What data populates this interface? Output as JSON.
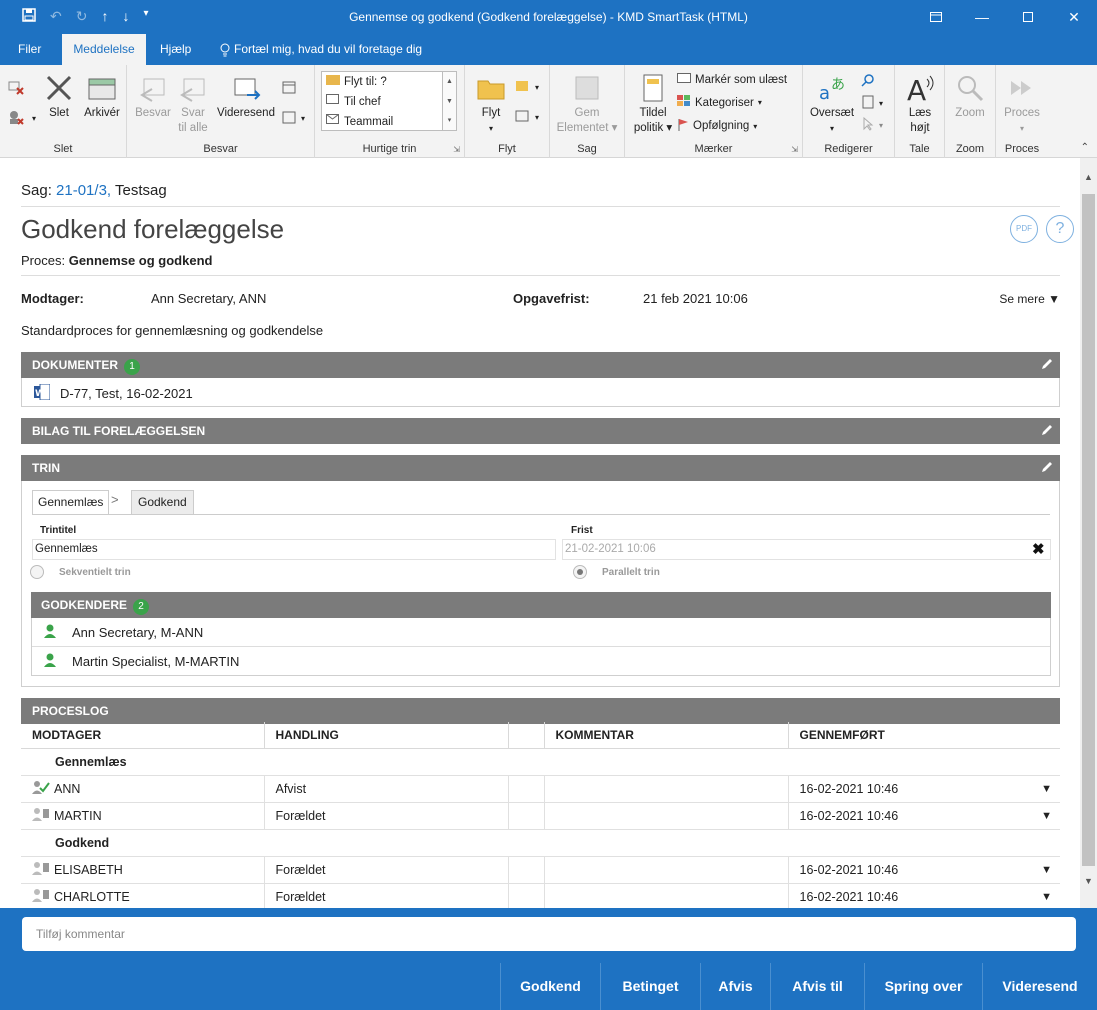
{
  "window": {
    "title": "Gennemse og godkend (Godkend forelæggelse)  -  KMD SmartTask (HTML)"
  },
  "tabs": [
    "Filer",
    "Meddelelse",
    "Hjælp",
    "Fortæl mig, hvad du vil foretage dig"
  ],
  "ribbon": {
    "slet": {
      "delete": "Slet",
      "archive": "Arkivér",
      "group": "Slet"
    },
    "besvar": {
      "reply": "Besvar",
      "reply_all_1": "Svar",
      "reply_all_2": "til alle",
      "forward": "Videresend",
      "group": "Besvar"
    },
    "quicksteps": {
      "items": [
        "Flyt til: ?",
        "Til chef",
        "Teammail"
      ],
      "group": "Hurtige trin"
    },
    "flyt": {
      "move": "Flyt",
      "group": "Flyt"
    },
    "sag": {
      "save_1": "Gem",
      "save_2": "Elementet",
      "group": "Sag"
    },
    "maerker": {
      "assign_1": "Tildel",
      "assign_2": "politik",
      "unread": "Markér som ulæst",
      "categorize": "Kategoriser",
      "followup": "Opfølgning",
      "group": "Mærker"
    },
    "rediger": {
      "translate": "Oversæt",
      "group": "Redigerer"
    },
    "tale": {
      "read_1": "Læs",
      "read_2": "højt",
      "group": "Tale"
    },
    "zoom": {
      "zoom": "Zoom",
      "group": "Zoom"
    },
    "proces": {
      "process": "Proces",
      "group": "Proces"
    }
  },
  "case": {
    "label": "Sag:",
    "number": "21-01/3,",
    "name": "Testsag"
  },
  "heading": "Godkend forelæggelse",
  "process": {
    "label": "Proces:",
    "value": "Gennemse og godkend"
  },
  "recipient": {
    "label": "Modtager:",
    "value": "Ann Secretary, ANN"
  },
  "deadline": {
    "label": "Opgavefrist:",
    "value": "21 feb 2021 10:06"
  },
  "see_more": "Se mere",
  "description": "Standardproces for gennemlæsning og godkendelse",
  "documents": {
    "title": "DOKUMENTER",
    "count": "1",
    "items": [
      "D-77, Test, 16-02-2021"
    ]
  },
  "attachments": {
    "title": "BILAG TIL FORELÆGGELSEN"
  },
  "steps": {
    "title": "TRIN",
    "tabs": [
      "Gennemlæs",
      "Godkend"
    ],
    "step_title_label": "Trintitel",
    "step_title_value": "Gennemlæs",
    "deadline_label": "Frist",
    "deadline_value": "21-02-2021 10:06",
    "sequential": "Sekventielt trin",
    "parallel": "Parallelt trin",
    "approvers_title": "GODKENDERE",
    "approvers_count": "2",
    "approvers": [
      "Ann Secretary, M-ANN",
      "Martin Specialist, M-MARTIN"
    ]
  },
  "log": {
    "title": "PROCESLOG",
    "columns": [
      "MODTAGER",
      "HANDLING",
      "",
      "KOMMENTAR",
      "GENNEMFØRT"
    ],
    "groups": [
      {
        "name": "Gennemlæs",
        "rows": [
          {
            "recipient": "ANN",
            "action": "Afvist",
            "done": "16-02-2021 10:46",
            "status": "check"
          },
          {
            "recipient": "MARTIN",
            "action": "Forældet",
            "done": "16-02-2021 10:46",
            "status": "grey"
          }
        ]
      },
      {
        "name": "Godkend",
        "rows": [
          {
            "recipient": "ELISABETH",
            "action": "Forældet",
            "done": "16-02-2021 10:46",
            "status": "grey"
          },
          {
            "recipient": "CHARLOTTE",
            "action": "Forældet",
            "done": "16-02-2021 10:46",
            "status": "grey"
          }
        ]
      }
    ]
  },
  "comment_placeholder": "Tilføj kommentar",
  "actions": [
    "Godkend",
    "Betinget",
    "Afvis",
    "Afvis til",
    "Spring over",
    "Videresend"
  ],
  "colors": {
    "accent": "#1e72c2",
    "section": "#7b7b7b",
    "badge": "#3aa34a",
    "link": "#1e72c2"
  }
}
